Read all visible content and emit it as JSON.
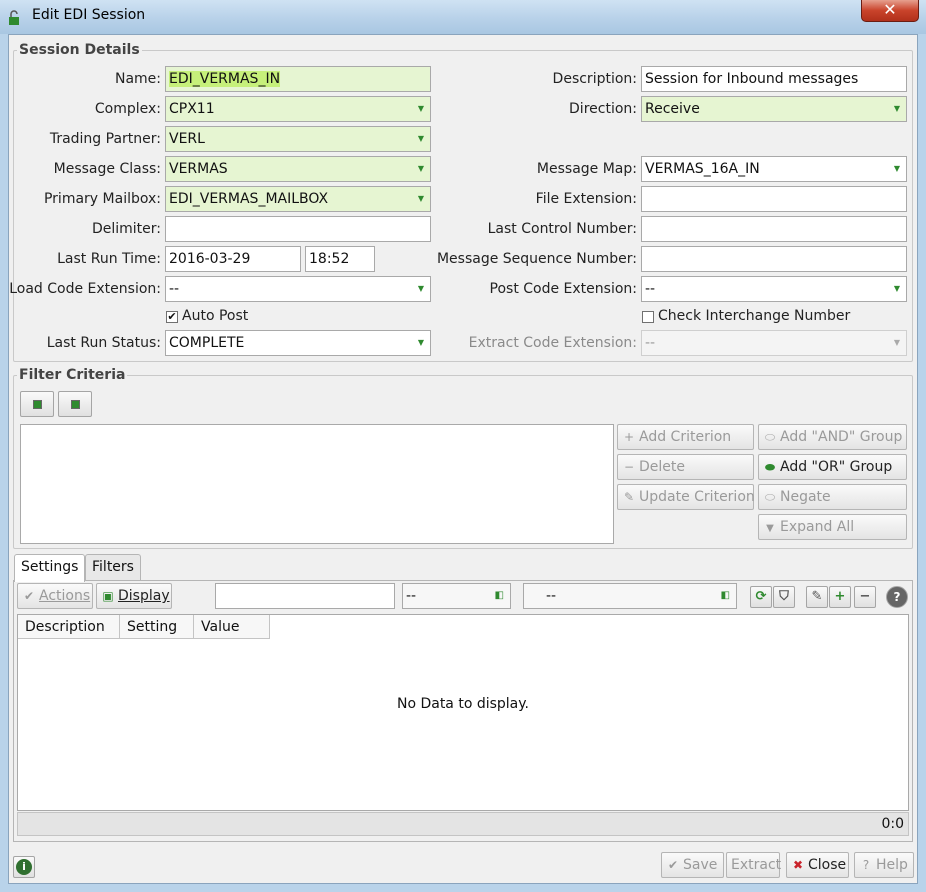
{
  "window": {
    "title": "Edit EDI Session",
    "close_glyph": "✕"
  },
  "session_details": {
    "title": "Session Details",
    "name": {
      "label": "Name:",
      "value": "EDI_VERMAS_IN"
    },
    "complex": {
      "label": "Complex:",
      "value": "CPX11"
    },
    "trading_partner": {
      "label": "Trading Partner:",
      "value": "VERL"
    },
    "message_class": {
      "label": "Message Class:",
      "value": "VERMAS"
    },
    "primary_mailbox": {
      "label": "Primary Mailbox:",
      "value": "EDI_VERMAS_MAILBOX"
    },
    "delimiter": {
      "label": "Delimiter:",
      "value": ""
    },
    "last_run_time": {
      "label": "Last Run Time:",
      "date": "2016-03-29",
      "time": "18:52"
    },
    "load_code_extension": {
      "label": "Load Code Extension:",
      "value": "--"
    },
    "auto_post": {
      "label": "Auto Post",
      "checked": true
    },
    "last_run_status": {
      "label": "Last Run Status:",
      "value": "COMPLETE"
    },
    "description": {
      "label": "Description:",
      "value": "Session for Inbound messages"
    },
    "direction": {
      "label": "Direction:",
      "value": "Receive"
    },
    "message_map": {
      "label": "Message Map:",
      "value": "VERMAS_16A_IN"
    },
    "file_extension": {
      "label": "File Extension:",
      "value": ""
    },
    "last_control_number": {
      "label": "Last Control Number:",
      "value": ""
    },
    "message_sequence_number": {
      "label": "Message Sequence Number:",
      "value": ""
    },
    "post_code_extension": {
      "label": "Post Code Extension:",
      "value": "--"
    },
    "check_interchange_number": {
      "label": "Check Interchange Number",
      "checked": false
    },
    "extract_code_extension": {
      "label": "Extract Code Extension:",
      "value": "--"
    }
  },
  "filter_criteria": {
    "title": "Filter Criteria",
    "buttons": {
      "add_criterion": "Add Criterion",
      "add_and_group": "Add \"AND\" Group",
      "delete": "Delete",
      "add_or_group": "Add \"OR\" Group",
      "update_criterion": "Update Criterion",
      "negate": "Negate",
      "expand_all": "Expand All"
    }
  },
  "tabs": {
    "settings": "Settings",
    "filters": "Filters"
  },
  "toolbar": {
    "actions": "Actions",
    "display": "Display",
    "search_value": "",
    "select1": "--",
    "select2": "--"
  },
  "grid": {
    "columns": [
      "Description",
      "Setting",
      "Value"
    ],
    "empty_message": "No Data to display.",
    "count": "0:0"
  },
  "footer": {
    "save": "Save",
    "extract": "Extract",
    "close": "Close",
    "help": "Help"
  },
  "colors": {
    "required_bg": "#e6f5d2",
    "highlight": "#c6f07a",
    "accent_green": "#2f8a2f",
    "close_red": "#c9432b"
  }
}
